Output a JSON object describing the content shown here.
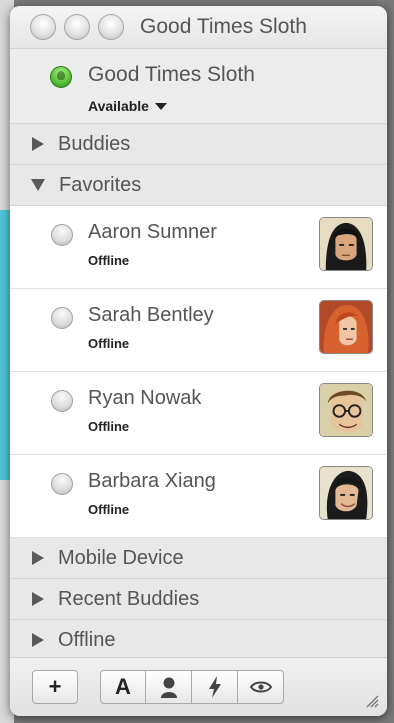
{
  "window": {
    "title": "Good Times Sloth"
  },
  "me": {
    "name": "Good Times Sloth",
    "status": "Available"
  },
  "groups": {
    "buddies": "Buddies",
    "favorites": "Favorites",
    "mobile": "Mobile Device",
    "recent": "Recent Buddies",
    "offline": "Offline"
  },
  "buddies": [
    {
      "name": "Aaron Sumner",
      "status": "Offline"
    },
    {
      "name": "Sarah Bentley",
      "status": "Offline"
    },
    {
      "name": "Ryan Nowak",
      "status": "Offline"
    },
    {
      "name": "Barbara Xiang",
      "status": "Offline"
    }
  ],
  "toolbar": {
    "add_label": "+",
    "font_label": "A"
  },
  "colors": {
    "available": "#5cc23a",
    "offline": "#d0d0d0",
    "accent_backdrop": "#4fc6d8"
  },
  "icons": {
    "add": "plus-icon",
    "font": "font-icon",
    "buddy_info": "person-icon",
    "actions": "lightning-icon",
    "privacy": "eye-icon",
    "resize": "resize-grip-icon"
  }
}
